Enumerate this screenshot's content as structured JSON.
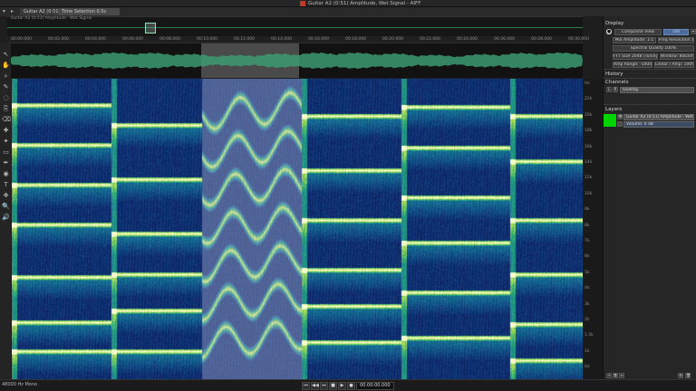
{
  "window": {
    "title": "Guitar A2 (0:51) Amplitude, Wet Signal - AIFF"
  },
  "tabs": [
    {
      "label": "Guitar A2 (0:51)"
    },
    {
      "label": "Time Selection 0.5s"
    }
  ],
  "overview": {
    "subtitle": "Guitar A2 (0:51) Amplitude · Wet Signal"
  },
  "ruler": {
    "ticks": [
      "00:00.000",
      "00:02.000",
      "00:04.000",
      "00:06.000",
      "00:08.000",
      "00:10.000",
      "00:12.000",
      "00:14.000",
      "00:16.000",
      "00:18.000",
      "00:20.000",
      "00:22.000",
      "00:24.000",
      "00:26.000",
      "00:28.000",
      "00:30.000"
    ]
  },
  "freq_axis": {
    "labels": [
      "Hz",
      "22k",
      "20k",
      "18k",
      "16k",
      "14k",
      "12k",
      "10k",
      "9k",
      "8k",
      "7k",
      "6k",
      "5k",
      "4k",
      "3k",
      "2k",
      "1.5k",
      "1k",
      "Hz"
    ]
  },
  "tools": [
    "pointer-icon",
    "hand-icon",
    "zoom-icon",
    "brush-icon",
    "lasso-icon",
    "clone-icon",
    "eraser-icon",
    "healing-icon",
    "wand-icon",
    "marquee-icon",
    "dropper-icon",
    "spot-icon",
    "text-icon",
    "pan-icon",
    "magnifier-icon",
    "speaker-icon"
  ],
  "panel": {
    "display_title": "Display",
    "display_mode": "Composite View",
    "display_mode_value": "100",
    "amp_label": "Mix Amplitude: 1:1",
    "amp_value": "Freq Resolution 100",
    "res_label": "Spectral Quality 100%",
    "res2_label": "FFT Size 2048 (Tuning)",
    "res2_value": "Window: Blackmn",
    "range_label": "Amp Range: -100dB",
    "range_value": "Linear / Amp: 100%",
    "history_title": "History",
    "channels_title": "Channels",
    "channel_values": [
      "L",
      "R"
    ],
    "channel_mode": "Overlay",
    "layers_title": "Layers",
    "layer_name": "Guitar A2 (0:51) Amplitude · Wet Signal",
    "layer_sub": "Volume: 0 dB",
    "layer_color": "#00d400"
  },
  "status": {
    "sample_rate": "48000 Hz Mono",
    "time": "00:00:00.000",
    "transport": [
      "⏮",
      "◀◀",
      "⏭",
      "■",
      "▶",
      "●"
    ]
  }
}
